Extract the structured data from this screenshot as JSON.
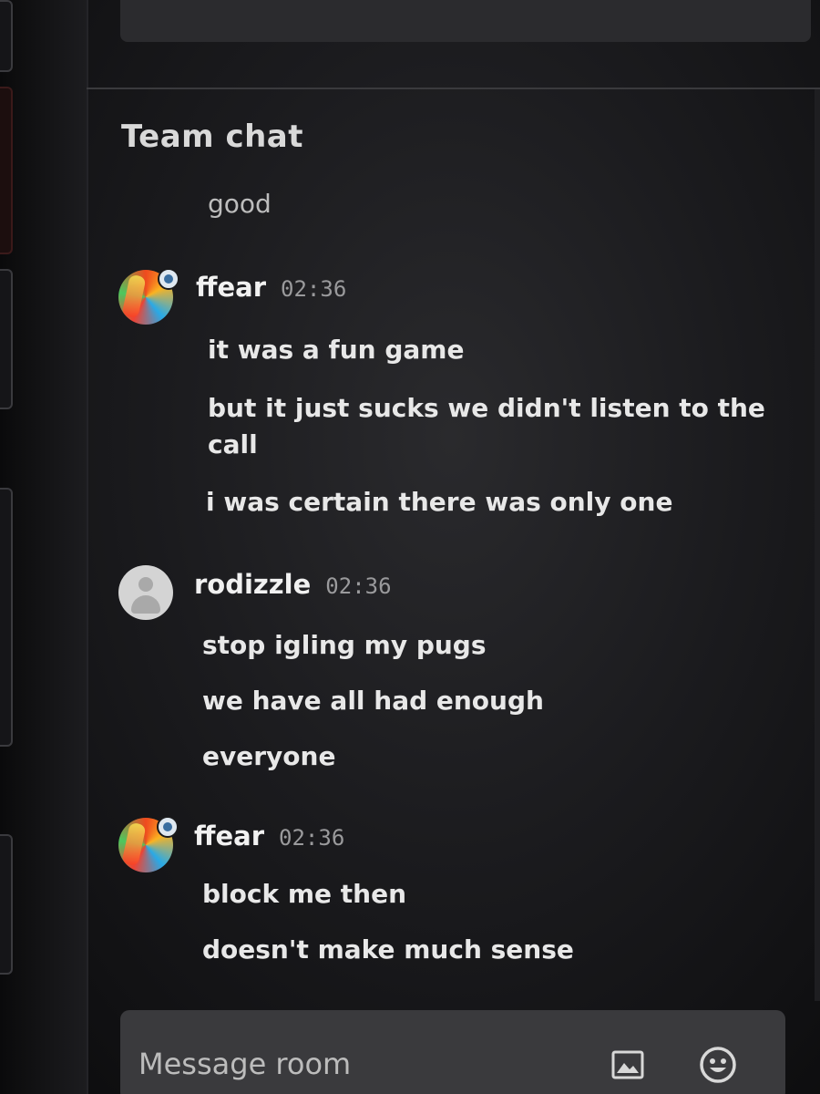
{
  "chat": {
    "title": "Team chat",
    "continuation_text": "good",
    "messages": [
      {
        "author": "ffear",
        "time": "02:36",
        "lines": [
          "it was a fun game",
          "but it just sucks we didn't listen to the call",
          "i was certain there was only one"
        ]
      },
      {
        "author": "rodizzle",
        "time": "02:36",
        "lines": [
          "stop igling my pugs",
          "we have all had enough",
          "everyone"
        ]
      },
      {
        "author": "ffear",
        "time": "02:36",
        "lines": [
          "block me then",
          "doesn't make much sense"
        ]
      }
    ]
  },
  "composer": {
    "placeholder": "Message room",
    "image_icon": "image-icon",
    "emoji_icon": "emoji-icon"
  }
}
